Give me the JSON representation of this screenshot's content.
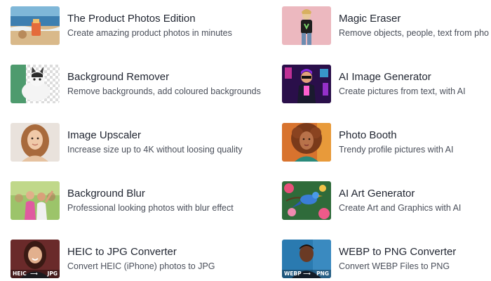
{
  "tools": [
    {
      "title": "The Product Photos Edition",
      "subtitle": "Create amazing product photos in minutes",
      "thumb_icon": "beach-product-thumbnail"
    },
    {
      "title": "Magic Eraser",
      "subtitle": "Remove objects, people, text from pho",
      "thumb_icon": "person-pink-background-thumbnail"
    },
    {
      "title": "Background Remover",
      "subtitle": "Remove backgrounds, add coloured backgrounds",
      "thumb_icon": "cat-transparent-thumbnail"
    },
    {
      "title": "AI Image Generator",
      "subtitle": "Create pictures from text, with AI",
      "thumb_icon": "neon-character-thumbnail"
    },
    {
      "title": "Image Upscaler",
      "subtitle": "Increase size up to 4K without loosing quality",
      "thumb_icon": "woman-portrait-thumbnail"
    },
    {
      "title": "Photo Booth",
      "subtitle": "Trendy profile pictures with AI",
      "thumb_icon": "curly-hair-portrait-thumbnail"
    },
    {
      "title": "Background Blur",
      "subtitle": "Professional looking photos with blur effect",
      "thumb_icon": "festival-crowd-thumbnail"
    },
    {
      "title": "AI Art Generator",
      "subtitle": "Create Art and Graphics with AI",
      "thumb_icon": "bird-flowers-thumbnail"
    },
    {
      "title": "HEIC to JPG Converter",
      "subtitle": "Convert HEIC (iPhone) photos to JPG",
      "thumb_icon": "woman-smiling-thumbnail",
      "badge_from": "HEIC",
      "badge_to": "JPG"
    },
    {
      "title": "WEBP to PNG Converter",
      "subtitle": "Convert WEBP Files to PNG",
      "thumb_icon": "man-portrait-thumbnail",
      "badge_from": "WEBP",
      "badge_to": "PNG"
    }
  ],
  "colors": {
    "title": "#1f2430",
    "subtitle": "#4a4f5a",
    "background": "#ffffff"
  }
}
